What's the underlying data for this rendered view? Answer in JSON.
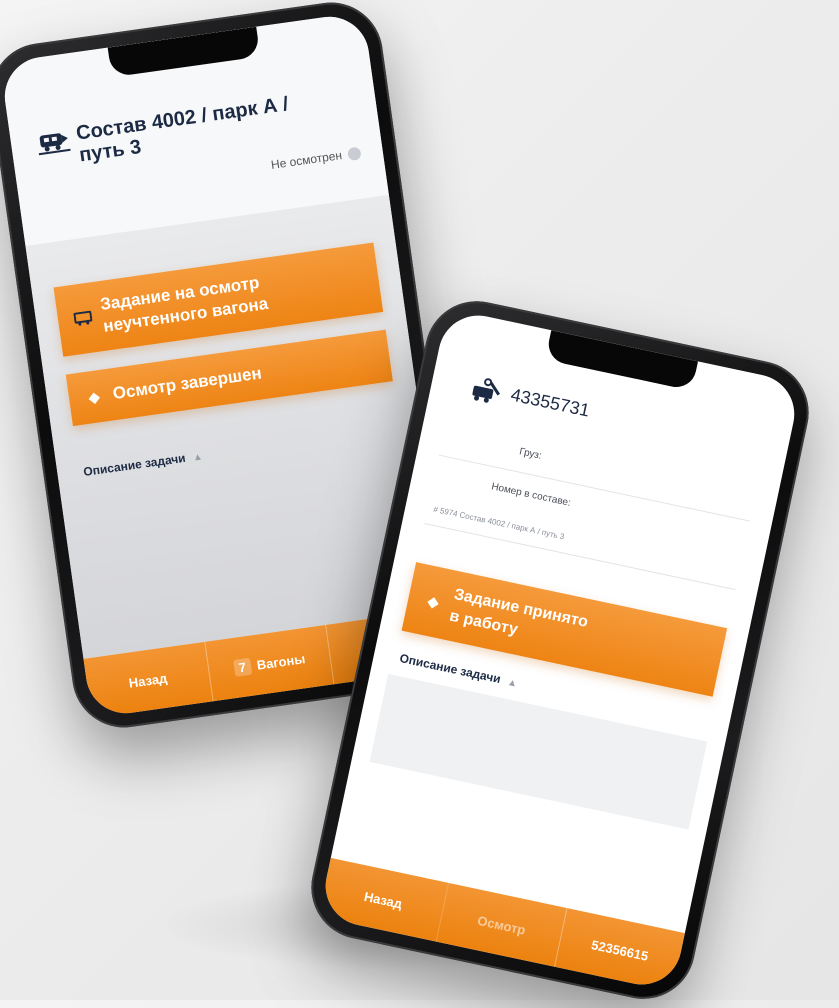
{
  "phone1": {
    "title": "Состав 4002 / парк А / путь 3",
    "status": "Не осмотрен",
    "buttons": {
      "task_uncounted": "Задание на осмотр неучтенного вагона",
      "inspection_done": "Осмотр завершен"
    },
    "description_label": "Описание задачи",
    "bottom_bar": {
      "back": "Назад",
      "wagons_count": "7",
      "wagons": "Вагоны"
    }
  },
  "phone2": {
    "title": "43355731",
    "field_1_label": "Груз:",
    "field_2_label": "Номер в составе:",
    "field_3_value": "# 5974 Состав 4002 / парк А / путь 3",
    "buttons": {
      "task_accepted": "Задание принято в работу"
    },
    "description_label": "Описание задачи",
    "bottom_bar": {
      "back": "Назад",
      "middle": "Осмотр",
      "number": "52356615"
    }
  },
  "colors": {
    "accent": "#ef8a1f",
    "title_text": "#1d2a44"
  },
  "icons": [
    "train-icon",
    "wagon-icon",
    "status-dot-icon",
    "caret-up-icon",
    "check-icon"
  ]
}
